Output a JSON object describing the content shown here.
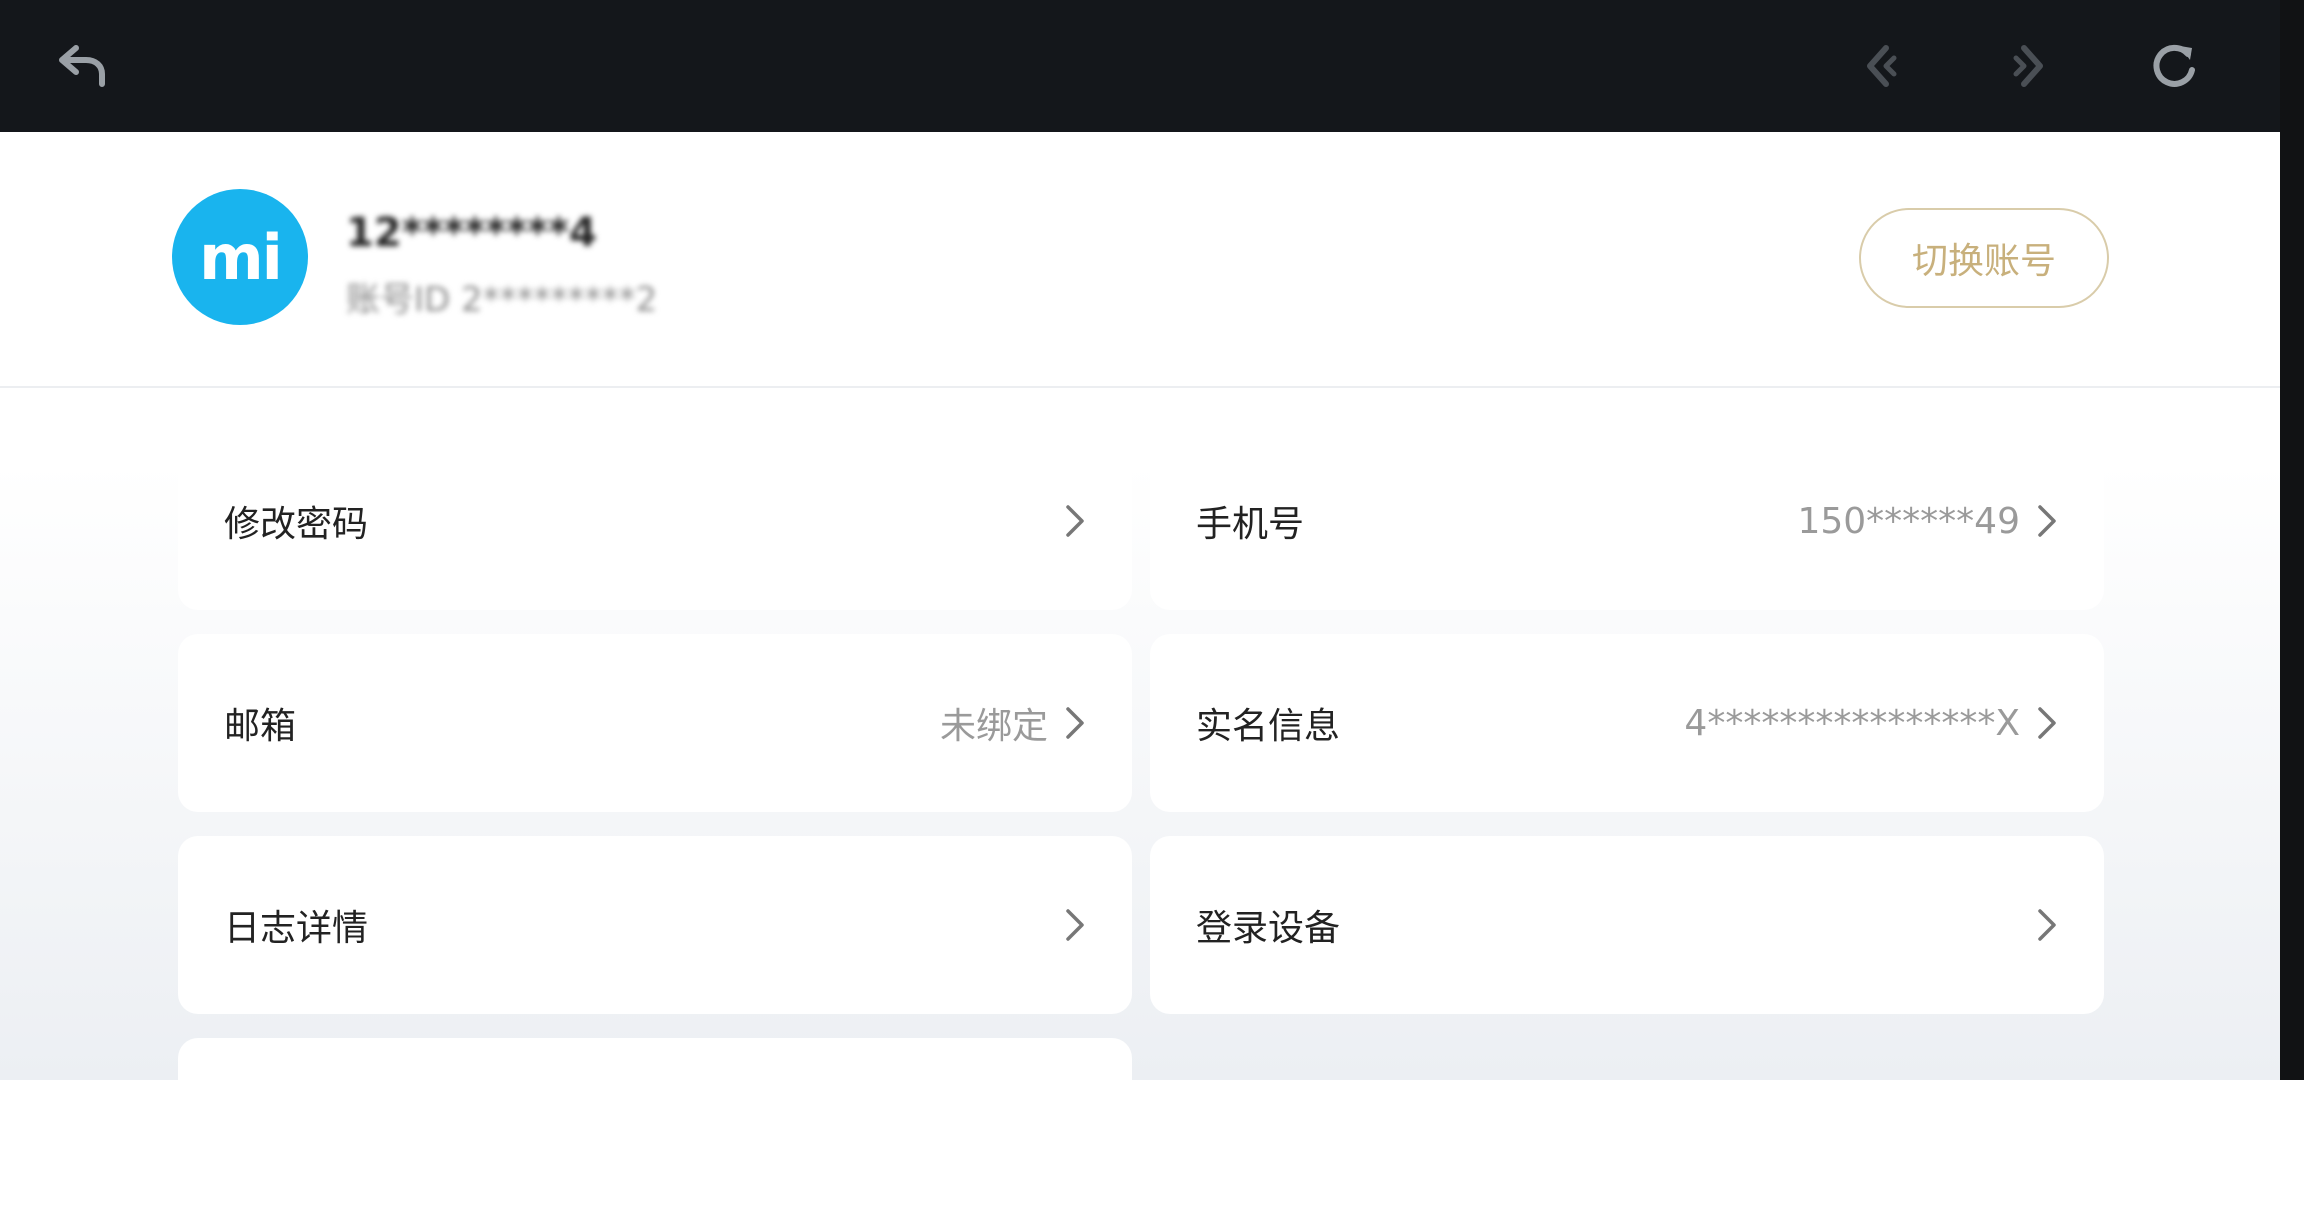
{
  "toolbar": {
    "back_icon": "undo-arrow-icon",
    "prev_icon": "arrow-left-icon",
    "next_icon": "arrow-right-icon",
    "refresh_icon": "refresh-icon"
  },
  "profile": {
    "avatar_text": "mi",
    "avatar_color": "#19b4ee",
    "username": "12********4",
    "user_id": "账号ID 2*********2",
    "switch_label": "切换账号"
  },
  "settings": {
    "items": [
      {
        "label": "修改密码",
        "value": ""
      },
      {
        "label": "手机号",
        "value": "150******49"
      },
      {
        "label": "邮箱",
        "value": "未绑定"
      },
      {
        "label": "实名信息",
        "value": "4****************X"
      },
      {
        "label": "日志详情",
        "value": ""
      },
      {
        "label": "登录设备",
        "value": ""
      },
      {
        "label": "",
        "value": ""
      }
    ]
  }
}
